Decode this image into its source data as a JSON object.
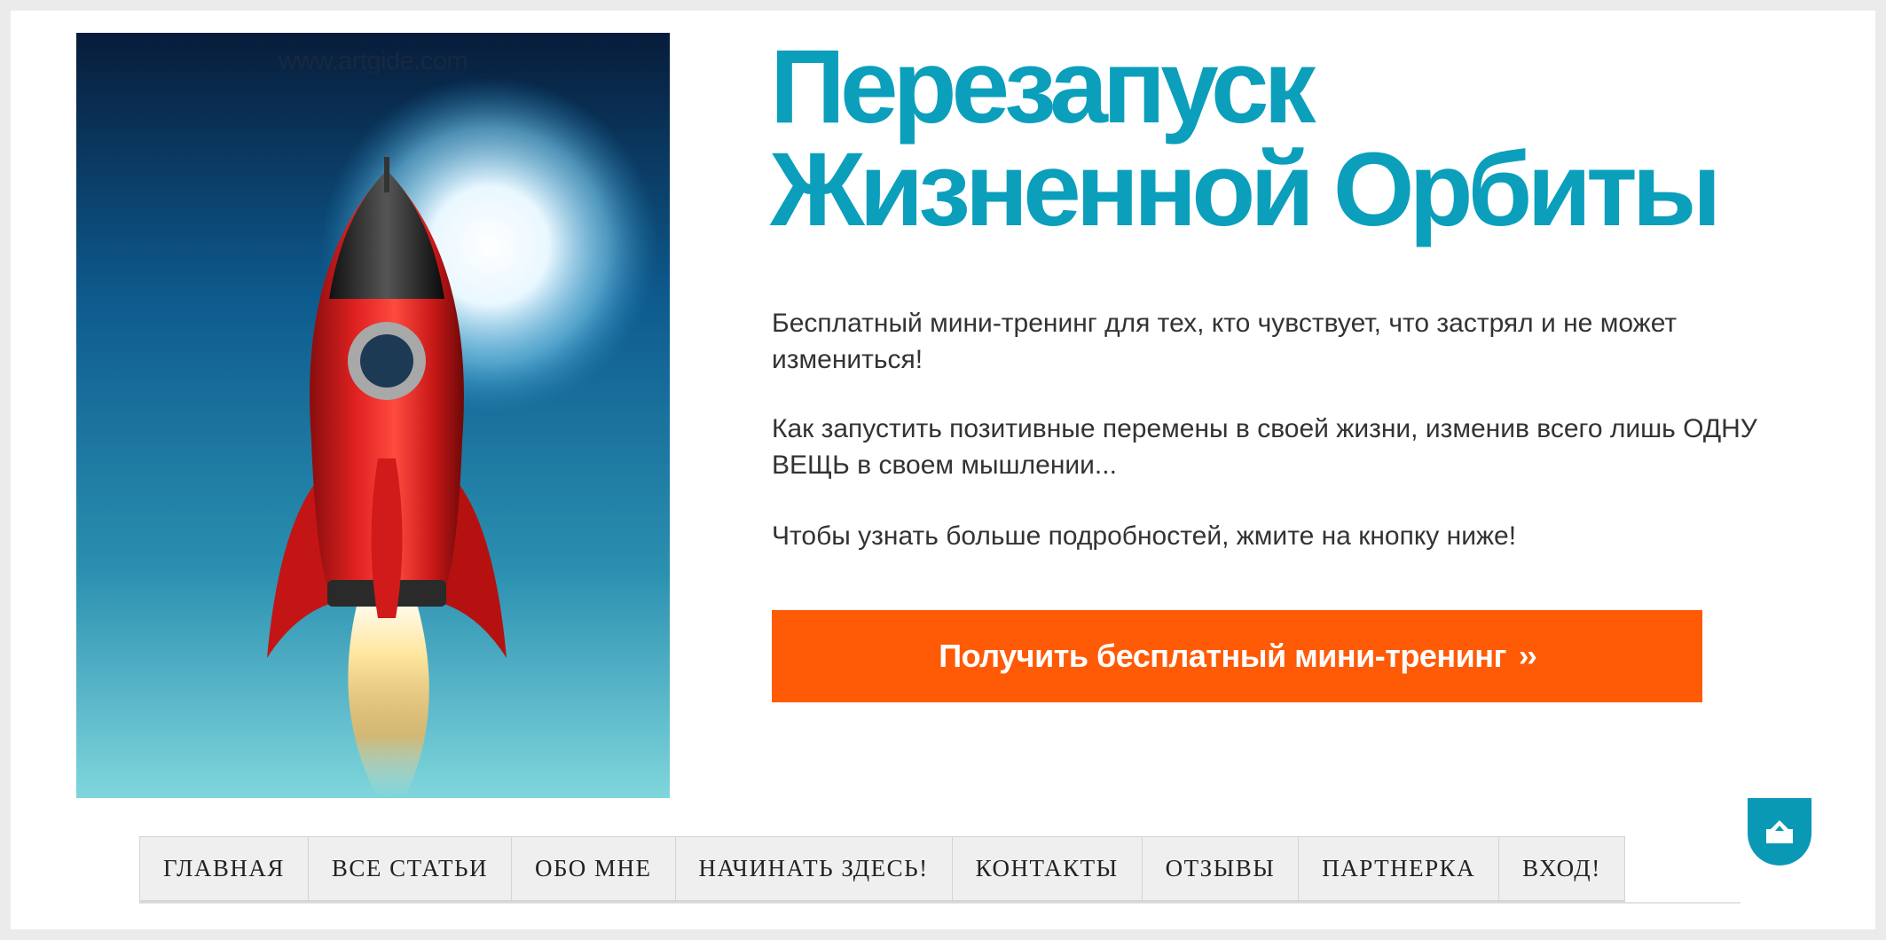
{
  "hero": {
    "watermark": "www.artgide.com",
    "image_alt": "red rocket launching"
  },
  "headline": {
    "line1": "Перезапуск",
    "line2": "Жизненной Орбиты"
  },
  "paragraphs": {
    "p1": "Бесплатный мини-тренинг для тех, кто чувствует, что застрял и не может измениться!",
    "p2": "Как запустить позитивные перемены в своей жизни, изменив всего лишь ОДНУ ВЕЩЬ в своем мышлении...",
    "p3": "Чтобы узнать больше подробностей, жмите на кнопку ниже!"
  },
  "cta": {
    "label": "Получить бесплатный мини-тренинг",
    "chevrons": "››"
  },
  "nav": {
    "items": [
      {
        "label": "ГЛАВНАЯ"
      },
      {
        "label": "ВСЕ СТАТЬИ"
      },
      {
        "label": "ОБО МНЕ"
      },
      {
        "label": "НАЧИНАТЬ ЗДЕСЬ!"
      },
      {
        "label": "КОНТАКТЫ"
      },
      {
        "label": "ОТЗЫВЫ"
      },
      {
        "label": "ПАРТНЕРКА"
      },
      {
        "label": "ВХОД!"
      }
    ]
  },
  "icons": {
    "scroll_top": "scroll-to-top-icon"
  },
  "colors": {
    "headline": "#0b9fbc",
    "cta": "#ff5a05",
    "scroll_button": "#0a99b5",
    "text": "#333333"
  }
}
